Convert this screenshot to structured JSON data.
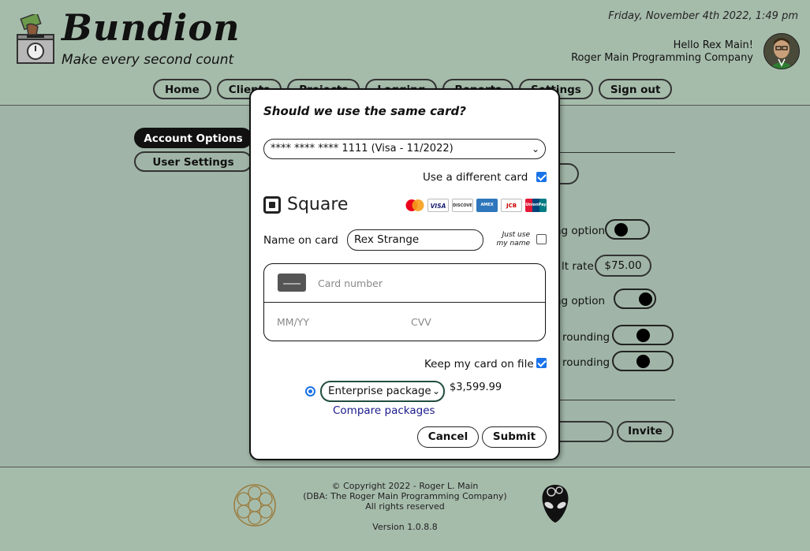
{
  "header": {
    "brand": "Bundion",
    "tagline": "Make every second count",
    "datetime": "Friday, November 4th 2022, 1:49 pm",
    "greeting": "Hello Rex Main!",
    "company": "Roger Main Programming Company"
  },
  "nav": {
    "items": [
      {
        "label": "Home"
      },
      {
        "label": "Clients"
      },
      {
        "label": "Projects"
      },
      {
        "label": "Logging"
      },
      {
        "label": "Reports"
      },
      {
        "label": "Settings"
      },
      {
        "label": "Sign out"
      }
    ]
  },
  "sidebar": {
    "items": [
      {
        "label": "Account Options",
        "active": true
      },
      {
        "label": "User Settings",
        "active": false
      }
    ]
  },
  "background_settings": {
    "billing_option_1": "ng option",
    "rate_label": "lt rate",
    "rate_value": "$75.00",
    "billing_option_2": "ng option",
    "rounding_1": "rounding",
    "rounding_2": "rounding",
    "invite_label": "Invite"
  },
  "modal": {
    "title": "Should we use the same card?",
    "saved_card": "**** **** **** 1111 (Visa - 11/2022)",
    "use_different_card_label": "Use a different card",
    "use_different_card_checked": true,
    "payment_provider": "Square",
    "card_brands": [
      "Mastercard",
      "VISA",
      "DISCOVER",
      "AMEX",
      "JCB",
      "UnionPay"
    ],
    "name_label": "Name on card",
    "name_value": "Rex Strange",
    "just_use_line1": "Just use",
    "just_use_line2": "my name",
    "just_use_checked": false,
    "card_number_placeholder": "Card number",
    "expiry_placeholder": "MM/YY",
    "cvv_placeholder": "CVV",
    "keep_card_label": "Keep my card on file",
    "keep_card_checked": true,
    "package_selected": "Enterprise package",
    "package_price": "$3,599.99",
    "compare_link": "Compare packages",
    "cancel_label": "Cancel",
    "submit_label": "Submit"
  },
  "footer": {
    "copyright": "© Copyright 2022 - Roger L. Main",
    "dba": "(DBA: The Roger Main Programming Company)",
    "rights": "All rights reserved",
    "version": "Version 1.0.8.8"
  },
  "colors": {
    "background": "#a0b5a7",
    "accent_blue": "#1a73e8",
    "link": "#1a1a8c",
    "select_border": "#214d3f"
  }
}
